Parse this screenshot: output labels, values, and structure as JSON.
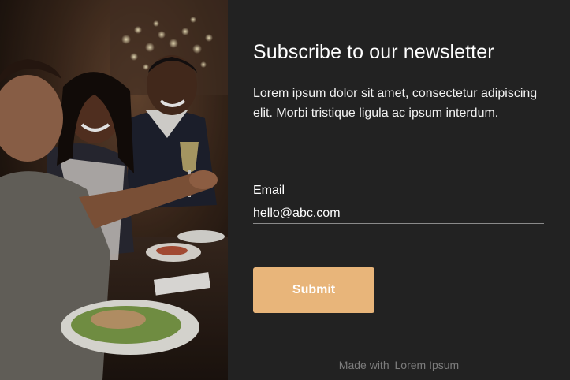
{
  "newsletter": {
    "title": "Subscribe to our newsletter",
    "description": "Lorem ipsum dolor sit amet, consectetur adipiscing elit. Morbi tristique ligula ac ipsum interdum.",
    "email_label": "Email",
    "email_value": "hello@abc.com",
    "submit_label": "Submit",
    "footer_prefix": "Made with",
    "footer_brand": "Lorem Ipsum"
  },
  "colors": {
    "panel_background": "#222222",
    "submit_button": "#e8b57a",
    "footer_text": "#7c7c7c"
  }
}
